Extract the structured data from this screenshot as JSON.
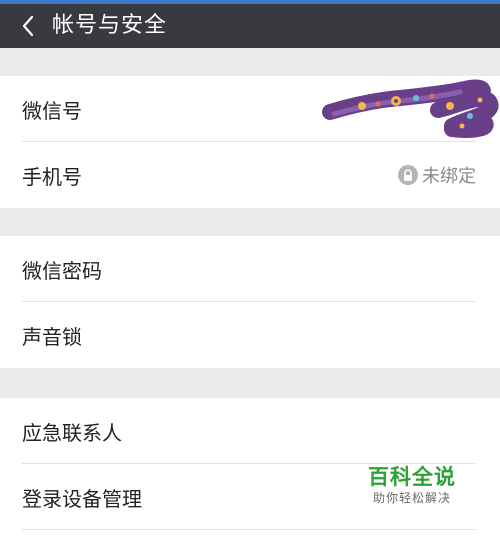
{
  "header": {
    "title": "帐号与安全",
    "back_icon": "chevron-left-icon",
    "background": "#393a3f",
    "status_strip_color": "#3f78c9"
  },
  "groups": [
    {
      "items": [
        {
          "label": "微信号"
        },
        {
          "label": "手机号",
          "status": "未绑定",
          "status_icon": "lock-icon"
        }
      ]
    },
    {
      "items": [
        {
          "label": "微信密码"
        },
        {
          "label": "声音锁"
        }
      ]
    },
    {
      "items": [
        {
          "label": "应急联系人"
        },
        {
          "label": "登录设备管理"
        }
      ]
    }
  ],
  "watermark": {
    "title": "百科全说",
    "subtitle": "助你轻松解决"
  }
}
